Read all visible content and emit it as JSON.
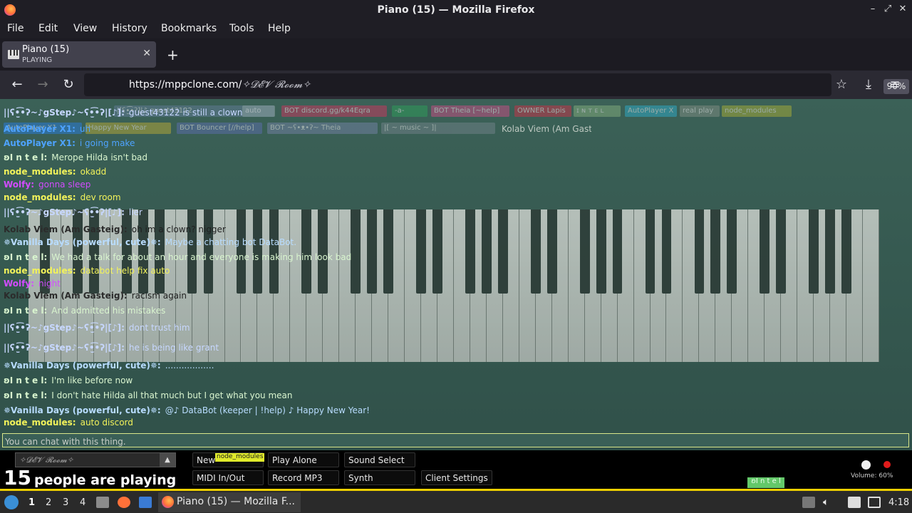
{
  "window": {
    "title": "Piano (15) — Mozilla Firefox"
  },
  "menu": {
    "items": [
      "File",
      "Edit",
      "View",
      "History",
      "Bookmarks",
      "Tools",
      "Help"
    ]
  },
  "tab": {
    "title": "Piano (15)",
    "subtitle": "PLAYING"
  },
  "navbar": {
    "url_host": "https://mppclone.com/",
    "url_path": "✧𝓓𝓔𝓥 𝓡𝓸𝓸𝓶✧",
    "zoom": "90%"
  },
  "tags": [
    "|[ʕ•̫͡•ʔ]|♪ guest43122",
    "auto",
    "BOT discord.gg/k44Eqra",
    "-a-",
    "BOT Theia [~help]",
    "OWNER Lapis",
    "ɪ ɴ ᴛ ᴇ ʟ",
    "AutoPlayer X",
    "real play",
    "node_modules",
    "AutoPlayer X1",
    "Happy New Year",
    "BOT Bouncer [//help]",
    "BOT ~ʕ•ᴥ•ʔ~ Theia",
    "|[ ~ music ~ ]|",
    "Kolab Viem (Am Gasteig)"
  ],
  "chat": [
    {
      "nick": "||ʕ•̫͡•ʔ~♪gStep♪~ʕ•̫͡•ʔ|[♪]:",
      "text": "guest43122 is still a clown",
      "color": "#c7d7ff"
    },
    {
      "nick": "AutoPlayer X1:",
      "text": "uh",
      "color": "#4ea3ff"
    },
    {
      "nick": "AutoPlayer X1:",
      "text": "i going make",
      "color": "#4ea3ff"
    },
    {
      "nick": "ʚI n t e l:",
      "text": "Merope Hilda isn't bad",
      "color": "#d9f5cf"
    },
    {
      "nick": "node_modules:",
      "text": "okadd",
      "color": "#f2f25a"
    },
    {
      "nick": "Wolfy:",
      "text": "gonna sleep",
      "color": "#d24cff"
    },
    {
      "nick": "node_modules:",
      "text": "dev room",
      "color": "#f2f25a"
    },
    {
      "nick": "||ʕ•̫͡•ʔ~♪gStep♪~ʕ•̫͡•ʔ|[♪]:",
      "text": "lier",
      "color": "#c7d7ff"
    },
    {
      "nick": "Kolab Viem (Am Gasteig):",
      "text": "oh im a clown? nigger",
      "color": "#2b2b2b"
    },
    {
      "nick": "✵Vanilla Days (powerful, cute)✵:",
      "text": "Maybe a chatting bot DataBot.",
      "color": "#b8dcff"
    },
    {
      "nick": "ʚI n t e l:",
      "text": "We had a talk for about an hour and everyone is making him look bad",
      "color": "#d9f5cf"
    },
    {
      "nick": "node_modules:",
      "text": "databot help fix auto",
      "color": "#f2f25a"
    },
    {
      "nick": "Wolfy:",
      "text": "night",
      "color": "#d24cff"
    },
    {
      "nick": "Kolab Viem (Am Gasteig):",
      "text": "racism again",
      "color": "#2b2b2b"
    },
    {
      "nick": "ʚI n t e l:",
      "text": "And admitted his mistakes",
      "color": "#d9f5cf"
    },
    {
      "nick": "||ʕ•̫͡•ʔ~♪gStep♪~ʕ•̫͡•ʔ|[♪]:",
      "text": "dont trust him",
      "color": "#c7d7ff"
    },
    {
      "nick": "||ʕ•̫͡•ʔ~♪gStep♪~ʕ•̫͡•ʔ|[♪]:",
      "text": "he is being like grant",
      "color": "#c7d7ff"
    },
    {
      "nick": "✵Vanilla Days (powerful, cute)✵:",
      "text": "..................",
      "color": "#b8dcff"
    },
    {
      "nick": "ʚI n t e l:",
      "text": "I'm like before now",
      "color": "#d9f5cf"
    },
    {
      "nick": "ʚI n t e l:",
      "text": "I don't hate Hilda all that much but I get what you mean",
      "color": "#d9f5cf"
    },
    {
      "nick": "✵Vanilla Days (powerful, cute)✵:",
      "text": "@♪ DataBot (keeper | !help) ♪ Happy New Year!",
      "color": "#b8dcff"
    },
    {
      "nick": "node_modules:",
      "text": "auto discord",
      "color": "#f2f25a"
    }
  ],
  "chat_input": {
    "placeholder": "You can chat with this thing."
  },
  "bottom": {
    "room": "✧𝓓𝓔𝓥 𝓡𝓸𝓸𝓶✧",
    "count": "15",
    "count_label": "people are playing",
    "node_flag": "node_modules",
    "buttons": [
      "New",
      "Play Alone",
      "Sound Select",
      "MIDI In/Out",
      "Record MP3",
      "Synth",
      "Client Settings"
    ],
    "volume": "Volume: 60%",
    "intel_badge": "ʚI n t e l"
  },
  "taskbar": {
    "workspaces": [
      "1",
      "2",
      "3",
      "4"
    ],
    "task_label": "Piano (15) — Mozilla F...",
    "clock": "4:18"
  }
}
